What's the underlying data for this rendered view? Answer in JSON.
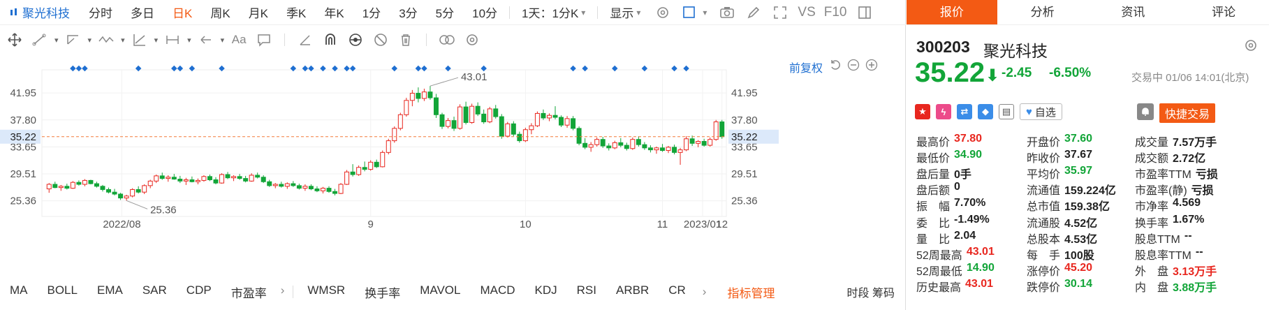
{
  "toolbar": {
    "stock_name": "聚光科技",
    "periods": [
      {
        "label": "分时",
        "active": false
      },
      {
        "label": "多日",
        "active": false
      },
      {
        "label": "日K",
        "active": true
      },
      {
        "label": "周K",
        "active": false
      },
      {
        "label": "月K",
        "active": false
      },
      {
        "label": "季K",
        "active": false
      },
      {
        "label": "年K",
        "active": false
      },
      {
        "label": "1分",
        "active": false
      },
      {
        "label": "3分",
        "active": false
      },
      {
        "label": "5分",
        "active": false
      },
      {
        "label": "10分",
        "active": false
      }
    ],
    "minute_select": "1天：1分K",
    "display_label": "显示",
    "vs_label": "VS",
    "f10_label": "F10"
  },
  "chart_header": {
    "fuquan_label": "前复权"
  },
  "chart_data": {
    "type": "candlestick",
    "ylim": [
      23.5,
      45.5
    ],
    "y_ticks_left": [
      "41.95",
      "37.80",
      "33.65",
      "29.51",
      "25.36"
    ],
    "y_ticks_right": [
      "41.95",
      "37.80",
      "33.65",
      "29.51",
      "25.36"
    ],
    "current_price_label": "35.22",
    "x_labels": [
      "2022/08",
      "9",
      "10",
      "11",
      "12",
      "2023/01"
    ],
    "annotations": [
      {
        "text": "43.01",
        "type": "high"
      },
      {
        "text": "25.36",
        "type": "low"
      }
    ],
    "candles": [
      [
        27.2,
        28.1,
        26.6,
        27.9
      ],
      [
        27.9,
        28.3,
        27.3,
        27.4
      ],
      [
        27.4,
        27.8,
        26.9,
        27.6
      ],
      [
        27.6,
        28.0,
        27.1,
        27.3
      ],
      [
        27.3,
        28.4,
        27.2,
        28.2
      ],
      [
        28.2,
        28.5,
        27.7,
        27.9
      ],
      [
        27.9,
        28.7,
        27.6,
        28.5
      ],
      [
        28.5,
        28.6,
        27.9,
        28.0
      ],
      [
        28.0,
        28.3,
        27.4,
        27.6
      ],
      [
        27.6,
        27.8,
        26.8,
        27.1
      ],
      [
        27.1,
        27.4,
        26.5,
        26.7
      ],
      [
        26.7,
        27.2,
        26.2,
        26.4
      ],
      [
        26.4,
        26.6,
        25.5,
        25.8
      ],
      [
        25.8,
        26.3,
        25.4,
        26.1
      ],
      [
        26.1,
        27.3,
        25.9,
        27.1
      ],
      [
        27.1,
        27.6,
        26.5,
        26.7
      ],
      [
        26.7,
        27.9,
        26.4,
        27.7
      ],
      [
        27.7,
        28.6,
        27.3,
        28.4
      ],
      [
        28.4,
        29.4,
        28.1,
        29.2
      ],
      [
        29.2,
        29.7,
        28.6,
        28.8
      ],
      [
        28.8,
        29.3,
        28.3,
        29.0
      ],
      [
        29.0,
        29.5,
        28.6,
        28.7
      ],
      [
        28.7,
        29.2,
        28.1,
        28.4
      ],
      [
        28.4,
        28.9,
        27.8,
        28.6
      ],
      [
        28.6,
        29.1,
        28.2,
        28.3
      ],
      [
        28.3,
        28.8,
        27.9,
        28.5
      ],
      [
        28.5,
        29.3,
        28.3,
        29.1
      ],
      [
        29.1,
        29.4,
        28.4,
        28.6
      ],
      [
        28.6,
        29.0,
        27.9,
        28.1
      ],
      [
        28.1,
        29.6,
        28.0,
        29.4
      ],
      [
        29.4,
        29.8,
        28.7,
        28.9
      ],
      [
        28.9,
        29.3,
        28.4,
        29.1
      ],
      [
        29.1,
        29.5,
        28.6,
        28.8
      ],
      [
        28.8,
        29.2,
        28.2,
        28.4
      ],
      [
        28.4,
        29.6,
        28.3,
        29.3
      ],
      [
        29.3,
        29.7,
        28.8,
        29.0
      ],
      [
        29.0,
        29.3,
        28.1,
        28.3
      ],
      [
        28.3,
        28.6,
        27.5,
        27.7
      ],
      [
        27.7,
        28.1,
        27.3,
        27.9
      ],
      [
        27.9,
        28.3,
        27.4,
        27.6
      ],
      [
        27.6,
        28.2,
        27.2,
        28.0
      ],
      [
        28.0,
        28.4,
        27.5,
        27.7
      ],
      [
        27.7,
        28.0,
        27.1,
        27.3
      ],
      [
        27.3,
        27.9,
        26.9,
        27.6
      ],
      [
        27.6,
        27.9,
        27.0,
        27.2
      ],
      [
        27.2,
        27.6,
        26.7,
        26.9
      ],
      [
        26.9,
        27.5,
        26.5,
        27.3
      ],
      [
        27.3,
        27.6,
        26.6,
        26.8
      ],
      [
        26.8,
        27.2,
        26.2,
        26.5
      ],
      [
        26.5,
        28.1,
        26.4,
        27.9
      ],
      [
        27.9,
        30.1,
        27.8,
        29.8
      ],
      [
        29.8,
        31.0,
        29.1,
        29.4
      ],
      [
        29.4,
        30.8,
        29.2,
        30.5
      ],
      [
        30.5,
        31.4,
        29.9,
        30.2
      ],
      [
        30.2,
        31.6,
        30.0,
        31.3
      ],
      [
        31.3,
        31.7,
        30.4,
        30.6
      ],
      [
        30.6,
        33.1,
        30.5,
        32.8
      ],
      [
        32.8,
        34.9,
        32.5,
        34.6
      ],
      [
        34.6,
        36.8,
        34.3,
        36.5
      ],
      [
        36.5,
        38.9,
        36.2,
        38.6
      ],
      [
        38.6,
        41.2,
        38.3,
        40.8
      ],
      [
        40.8,
        42.4,
        39.9,
        41.9
      ],
      [
        41.9,
        42.8,
        40.5,
        41.1
      ],
      [
        41.1,
        42.6,
        40.7,
        42.1
      ],
      [
        42.1,
        43.01,
        40.9,
        41.2
      ],
      [
        41.2,
        41.8,
        38.1,
        38.6
      ],
      [
        38.6,
        38.9,
        36.4,
        36.8
      ],
      [
        36.8,
        38.1,
        36.5,
        37.7
      ],
      [
        37.7,
        38.3,
        36.1,
        36.5
      ],
      [
        36.5,
        40.2,
        36.3,
        39.8
      ],
      [
        39.8,
        40.6,
        37.1,
        37.4
      ],
      [
        37.4,
        40.3,
        37.2,
        39.9
      ],
      [
        39.9,
        40.5,
        38.4,
        38.7
      ],
      [
        38.7,
        39.4,
        37.2,
        37.5
      ],
      [
        37.5,
        39.8,
        37.3,
        39.5
      ],
      [
        39.5,
        40.1,
        38.0,
        38.3
      ],
      [
        38.3,
        38.7,
        34.9,
        35.3
      ],
      [
        35.3,
        37.5,
        35.1,
        37.2
      ],
      [
        37.2,
        37.6,
        35.3,
        35.6
      ],
      [
        35.6,
        36.0,
        34.3,
        34.6
      ],
      [
        34.6,
        36.6,
        34.4,
        36.3
      ],
      [
        36.3,
        37.3,
        35.6,
        36.9
      ],
      [
        36.9,
        39.1,
        36.7,
        38.8
      ],
      [
        38.8,
        39.4,
        37.8,
        38.1
      ],
      [
        38.1,
        38.8,
        37.6,
        38.5
      ],
      [
        38.5,
        39.9,
        37.9,
        38.2
      ],
      [
        38.2,
        38.5,
        36.7,
        37.0
      ],
      [
        37.0,
        38.4,
        36.6,
        38.0
      ],
      [
        38.0,
        38.4,
        36.2,
        36.5
      ],
      [
        36.5,
        36.8,
        33.9,
        34.2
      ],
      [
        34.2,
        35.0,
        33.3,
        33.6
      ],
      [
        33.6,
        34.4,
        32.9,
        34.0
      ],
      [
        34.0,
        35.1,
        33.7,
        34.8
      ],
      [
        34.8,
        35.2,
        33.5,
        33.8
      ],
      [
        33.8,
        34.2,
        33.1,
        33.5
      ],
      [
        33.5,
        34.6,
        33.3,
        34.3
      ],
      [
        34.3,
        35.0,
        33.6,
        33.9
      ],
      [
        33.9,
        34.3,
        33.1,
        33.4
      ],
      [
        33.4,
        35.1,
        33.2,
        34.8
      ],
      [
        34.8,
        35.3,
        33.7,
        34.0
      ],
      [
        34.0,
        34.4,
        33.2,
        33.5
      ],
      [
        33.5,
        33.9,
        32.8,
        33.2
      ],
      [
        33.2,
        33.7,
        32.6,
        33.5
      ],
      [
        33.5,
        34.1,
        32.9,
        33.1
      ],
      [
        33.1,
        33.8,
        32.7,
        33.6
      ],
      [
        33.6,
        34.0,
        32.5,
        32.8
      ],
      [
        32.8,
        33.5,
        30.9,
        33.2
      ],
      [
        33.2,
        35.3,
        33.0,
        34.9
      ],
      [
        34.9,
        35.4,
        33.8,
        34.2
      ],
      [
        34.2,
        34.7,
        33.6,
        34.5
      ],
      [
        34.5,
        34.9,
        33.7,
        33.9
      ],
      [
        33.9,
        35.1,
        33.7,
        34.8
      ],
      [
        34.8,
        37.8,
        34.6,
        37.5
      ],
      [
        37.5,
        37.8,
        34.9,
        35.22
      ]
    ]
  },
  "indicators": [
    "MA",
    "BOLL",
    "EMA",
    "SAR",
    "CDP",
    "市盈率",
    "WMSR",
    "换手率",
    "MAVOL",
    "MACD",
    "KDJ",
    "RSI",
    "ARBR",
    "CR"
  ],
  "indicator_manage": "指标管理",
  "time_chips": "时段 筹码",
  "panel": {
    "tabs": [
      {
        "label": "报价",
        "active": true
      },
      {
        "label": "分析",
        "active": false
      },
      {
        "label": "资讯",
        "active": false
      },
      {
        "label": "评论",
        "active": false
      }
    ],
    "code": "300203",
    "name": "聚光科技",
    "price": "35.22",
    "change": "-2.45",
    "change_pct": "-6.50%",
    "status": "交易中 01/06 14:01(北京)",
    "zixuan_label": "自选",
    "trade_label": "快捷交易",
    "rows": [
      [
        {
          "label": "最高价",
          "value": "37.80",
          "color": "red"
        },
        {
          "label": "开盘价",
          "value": "37.60",
          "color": "green"
        },
        {
          "label": "成交量",
          "value": "7.57万手",
          "color": "dark"
        }
      ],
      [
        {
          "label": "最低价",
          "value": "34.90",
          "color": "green"
        },
        {
          "label": "昨收价",
          "value": "37.67",
          "color": "dark"
        },
        {
          "label": "成交额",
          "value": "2.72亿",
          "color": "dark"
        }
      ],
      [
        {
          "label": "盘后量",
          "value": "0手",
          "color": "dark"
        },
        {
          "label": "平均价",
          "value": "35.97",
          "color": "green"
        },
        {
          "label": "市盈率TTM",
          "value": "亏损",
          "color": "dark"
        }
      ],
      [
        {
          "label": "盘后额",
          "value": "0",
          "color": "dark"
        },
        {
          "label": "流通值",
          "value": "159.224亿",
          "color": "dark"
        },
        {
          "label": "市盈率(静)",
          "value": "亏损",
          "color": "dark"
        }
      ],
      [
        {
          "label": "振　幅",
          "value": "7.70%",
          "color": "dark"
        },
        {
          "label": "总市值",
          "value": "159.38亿",
          "color": "dark"
        },
        {
          "label": "市净率",
          "value": "4.569",
          "color": "dark"
        }
      ],
      [
        {
          "label": "委　比",
          "value": "-1.49%",
          "color": "dark"
        },
        {
          "label": "流通股",
          "value": "4.52亿",
          "color": "dark"
        },
        {
          "label": "换手率",
          "value": "1.67%",
          "color": "dark"
        }
      ],
      [
        {
          "label": "量　比",
          "value": "2.04",
          "color": "dark"
        },
        {
          "label": "总股本",
          "value": "4.53亿",
          "color": "dark"
        },
        {
          "label": "股息TTM",
          "value": "--",
          "color": "dark"
        }
      ],
      [
        {
          "label": "52周最高",
          "value": "43.01",
          "color": "red"
        },
        {
          "label": "每　手",
          "value": "100股",
          "color": "dark"
        },
        {
          "label": "股息率TTM",
          "value": "--",
          "color": "dark"
        }
      ],
      [
        {
          "label": "52周最低",
          "value": "14.90",
          "color": "green"
        },
        {
          "label": "涨停价",
          "value": "45.20",
          "color": "red"
        },
        {
          "label": "外　盘",
          "value": "3.13万手",
          "color": "red"
        }
      ],
      [
        {
          "label": "历史最高",
          "value": "43.01",
          "color": "red"
        },
        {
          "label": "跌停价",
          "value": "30.14",
          "color": "green"
        },
        {
          "label": "内　盘",
          "value": "3.88万手",
          "color": "green"
        }
      ]
    ]
  },
  "colors": {
    "up": "#e8271f",
    "down": "#12a538",
    "accent": "#f35a14",
    "link": "#1f6fd1",
    "price_line": "#f37b3a"
  }
}
